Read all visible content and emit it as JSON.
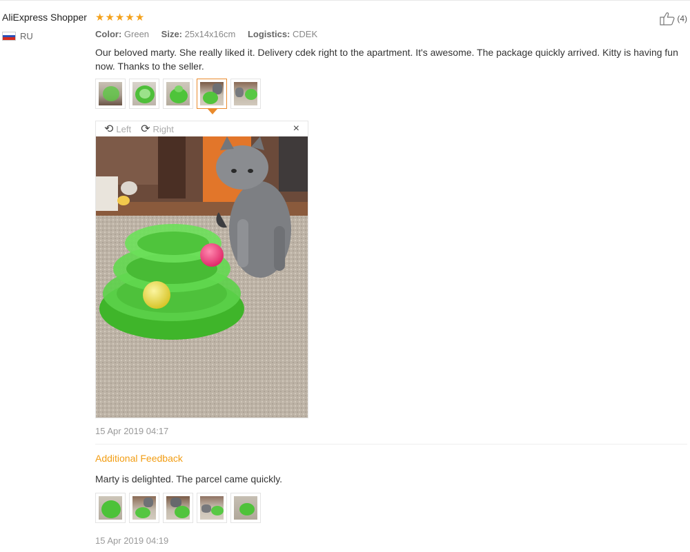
{
  "review": {
    "reviewer": "AliExpress Shopper",
    "rating": 5,
    "country_code": "RU",
    "helpful_count": "(4)",
    "meta": {
      "color_key": "Color:",
      "color_val": "Green",
      "size_key": "Size:",
      "size_val": "25x14x16cm",
      "logistics_key": "Logistics:",
      "logistics_val": "CDEK"
    },
    "text": "Our beloved marty. She really liked it. Delivery cdek right to the apartment. It's awesome. The package quickly arrived. Kitty is having fun now. Thanks to the seller.",
    "viewer": {
      "left_label": "Left",
      "right_label": "Right",
      "close": "×"
    },
    "date": "15 Apr 2019 04:17"
  },
  "additional": {
    "title": "Additional Feedback",
    "text": "Marty is delighted. The parcel came quickly.",
    "date": "15 Apr 2019 04:19"
  },
  "colors": {
    "star": "#f4a21d",
    "accent": "#e98a2c",
    "feedback_title": "#f29d13"
  }
}
